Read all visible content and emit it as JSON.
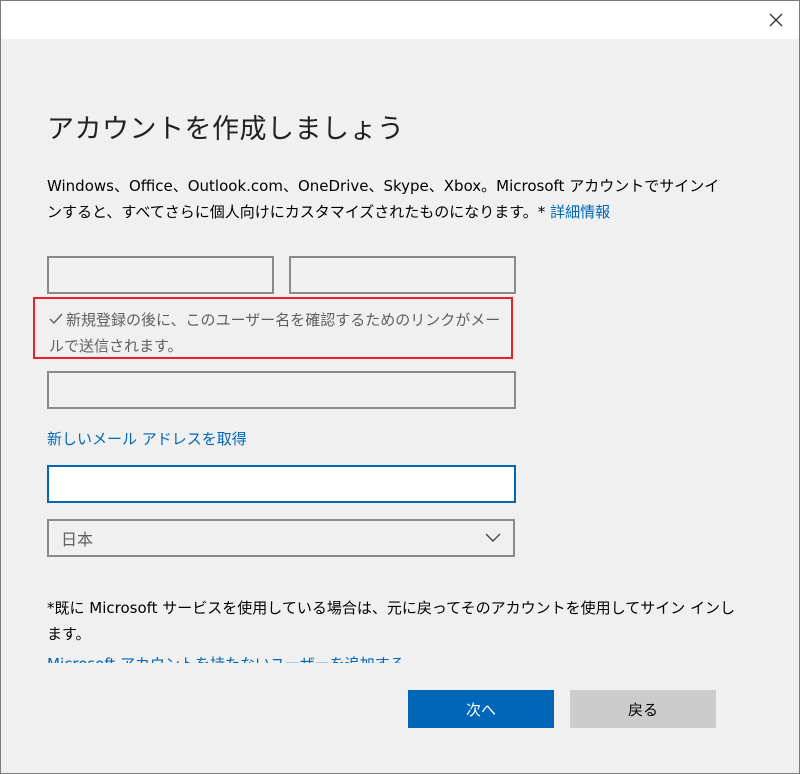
{
  "window": {
    "close_glyph": "✕"
  },
  "page": {
    "title": "アカウントを作成しましょう",
    "description_text": "Windows、Office、Outlook.com、OneDrive、Skype、Xbox。Microsoft アカウントでサインインすると、すべてさらに個人向けにカスタマイズされたものになります。* ",
    "details_link": "詳細情報"
  },
  "form": {
    "last_name": {
      "value": "",
      "placeholder": ""
    },
    "first_name": {
      "value": "",
      "placeholder": ""
    },
    "hint_text": "新規登録の後に、このユーザー名を確認するためのリンクがメールで送信されます。",
    "username": {
      "value": "",
      "placeholder": ""
    },
    "new_email_link": "新しいメール アドレスを取得",
    "password": {
      "value": "",
      "placeholder": ""
    },
    "country": {
      "selected": "日本"
    }
  },
  "footnote": {
    "text": "*既に Microsoft サービスを使用している場合は、元に戻ってそのアカウントを使用してサイン インします。",
    "add_user_link": "Microsoft アカウントを持たないユーザーを追加する"
  },
  "buttons": {
    "next": "次へ",
    "back": "戻る"
  },
  "colors": {
    "accent": "#0067b8",
    "highlight_border": "#e8202a"
  }
}
